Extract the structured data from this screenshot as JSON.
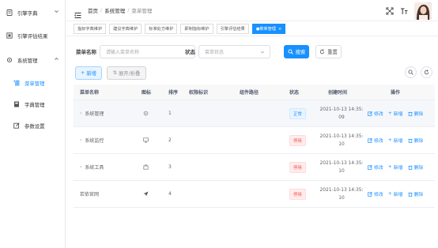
{
  "sidebar": {
    "items": [
      {
        "label": "引擎字典",
        "icon": "dictionary-icon",
        "chevron": "chevron-down-icon"
      },
      {
        "label": "引擎评估结果",
        "icon": "result-icon"
      },
      {
        "label": "系统管理",
        "icon": "gear-icon",
        "chevron": "chevron-up-icon"
      },
      {
        "label": "菜单管理",
        "icon": "tree-table-icon",
        "active": true
      },
      {
        "label": "字典管理",
        "icon": "dict-book-icon"
      },
      {
        "label": "参数设置",
        "icon": "edit-icon"
      }
    ]
  },
  "header": {
    "breadcrumb": [
      "首页",
      "系统管理",
      "菜单管理"
    ],
    "right_icons": [
      "fullscreen-icon",
      "font-size-icon"
    ]
  },
  "tags": [
    {
      "label": "指标字典维护"
    },
    {
      "label": "建议字典维护"
    },
    {
      "label": "标准处方维护"
    },
    {
      "label": "即制指标维护"
    },
    {
      "label": "引擎评估结果"
    },
    {
      "label": "●菜单管理",
      "active": true,
      "close": "×"
    }
  ],
  "search": {
    "menu_name_label": "菜单名称",
    "menu_name_placeholder": "请输入菜单名称",
    "status_label": "状态",
    "status_placeholder": "菜单状态",
    "search_button": "搜索",
    "reset_button": "重置"
  },
  "toolbar": {
    "add_button": "新增",
    "expand_button": "展开/折叠"
  },
  "table": {
    "columns": [
      "菜单名称",
      "图标",
      "排序",
      "权限标识",
      "组件路径",
      "状态",
      "创建时间",
      "操作"
    ],
    "rows": [
      {
        "name": "系统管理",
        "expandable": true,
        "icon": "system-icon",
        "order": "1",
        "perm": "",
        "path": "",
        "status": "正常",
        "status_type": "ok",
        "time1": "2021-10-13 14:35:",
        "time2": "09"
      },
      {
        "name": "系统监控",
        "expandable": true,
        "icon": "monitor-icon",
        "order": "2",
        "perm": "",
        "path": "",
        "status": "停用",
        "status_type": "off",
        "time1": "2021-10-13 14:35:",
        "time2": "10"
      },
      {
        "name": "系统工具",
        "expandable": true,
        "icon": "tool-icon",
        "order": "3",
        "perm": "",
        "path": "",
        "status": "停用",
        "status_type": "off",
        "time1": "2021-10-13 14:35:",
        "time2": "10"
      },
      {
        "name": "若依官网",
        "expandable": false,
        "icon": "guide-icon",
        "order": "4",
        "perm": "",
        "path": "",
        "status": "停用",
        "status_type": "off",
        "time1": "2021-10-13 14:35:",
        "time2": "10"
      }
    ],
    "actions": {
      "edit": "修改",
      "add": "新增",
      "delete": "删除"
    }
  },
  "colors": {
    "primary": "#1890ff",
    "danger": "#ff4949"
  }
}
